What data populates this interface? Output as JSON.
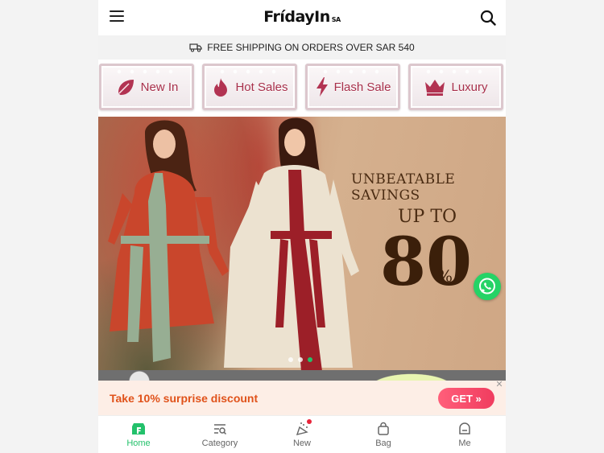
{
  "header": {
    "brand": "FrídayIn",
    "region": "SA"
  },
  "shipping_banner": "FREE SHIPPING ON ORDERS OVER SAR 540",
  "categories": [
    {
      "label": "New In",
      "icon": "leaf-icon"
    },
    {
      "label": "Hot Sales",
      "icon": "flame-icon"
    },
    {
      "label": "Flash Sale",
      "icon": "lightning-icon"
    },
    {
      "label": "Luxury",
      "icon": "crown-icon"
    }
  ],
  "hero": {
    "headline": "UNBEATABLE SAVINGS",
    "upto": "UP TO",
    "number": "80",
    "percent": "%",
    "slides_total": 3,
    "active_slide": 3
  },
  "coupon": {
    "text": "Take 10% surprise discount",
    "button": "GET »"
  },
  "nav": [
    {
      "label": "Home",
      "icon": "home-icon",
      "active": true
    },
    {
      "label": "Category",
      "icon": "category-icon"
    },
    {
      "label": "New",
      "icon": "new-icon",
      "badge": true
    },
    {
      "label": "Bag",
      "icon": "bag-icon"
    },
    {
      "label": "Me",
      "icon": "me-icon"
    }
  ],
  "colors": {
    "accent": "#23c16b",
    "tile_text": "#a8304b",
    "coupon_text": "#e0521a",
    "get_button": "#f03c5f"
  }
}
